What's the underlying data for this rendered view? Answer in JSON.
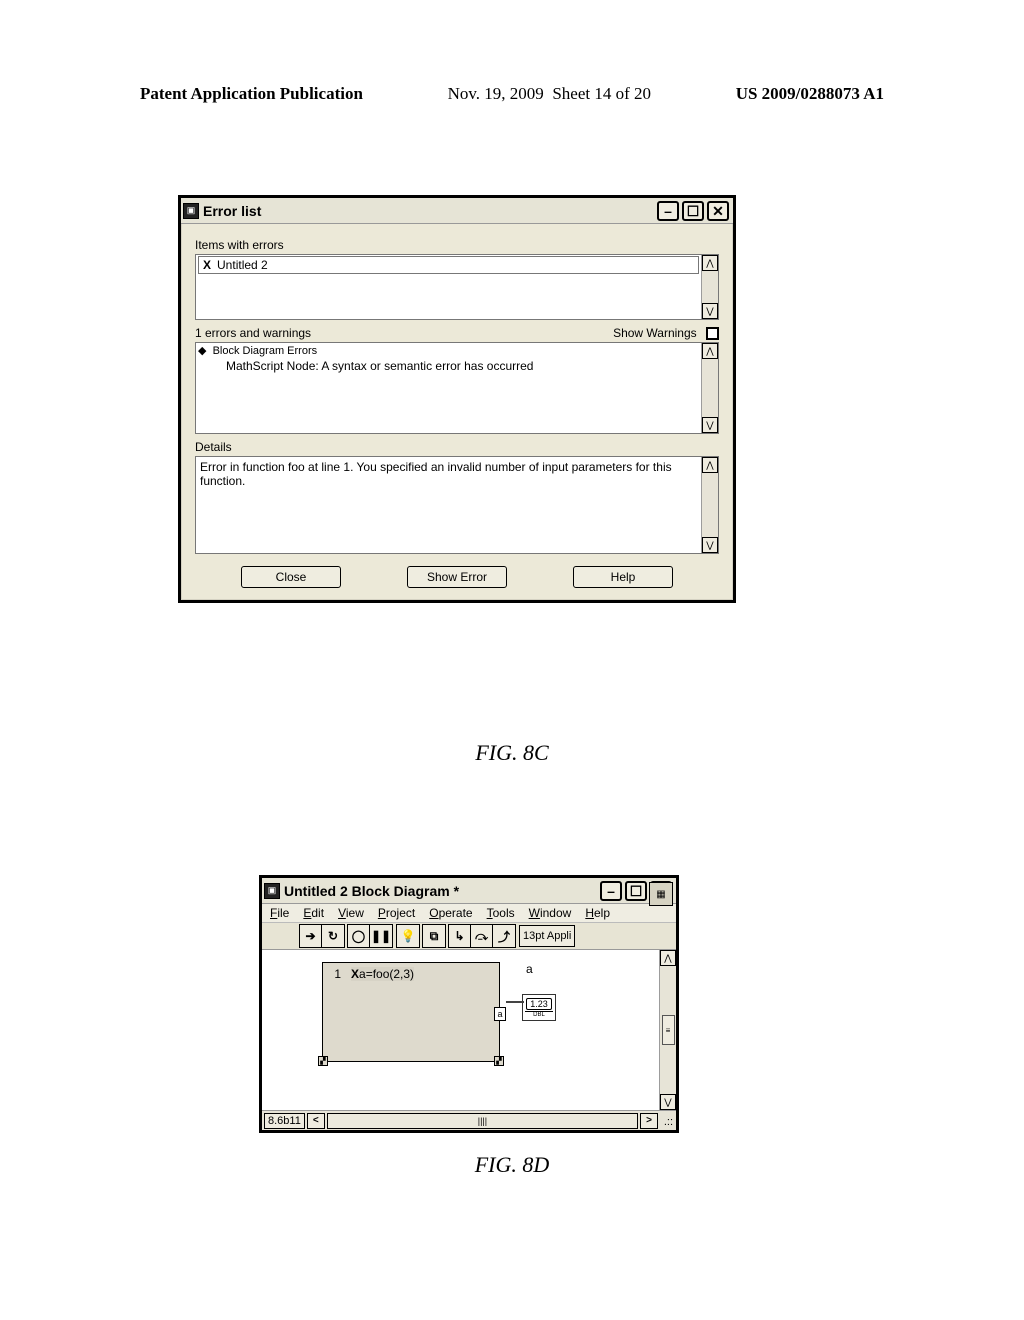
{
  "page_header": {
    "left": "Patent Application Publication",
    "date": "Nov. 19, 2009",
    "sheet": "Sheet 14 of 20",
    "pubno": "US 2009/0288073 A1"
  },
  "error_window": {
    "title": "Error list",
    "items_label": "Items with errors",
    "items": [
      {
        "name": "Untitled 2"
      }
    ],
    "errors_count_row": "1 errors and warnings",
    "show_warnings_label": "Show Warnings",
    "errors_section": {
      "heading": "Block Diagram Errors",
      "lines": [
        "MathScript Node: A syntax or semantic error has occurred"
      ]
    },
    "details_label": "Details",
    "details_text": "Error in function foo at line 1.  You specified an invalid number of input parameters for this function.",
    "buttons": {
      "close": "Close",
      "show_error": "Show Error",
      "help": "Help"
    }
  },
  "fig_caption_1": "FIG. 8C",
  "bd_window": {
    "title": "Untitled 2 Block Diagram *",
    "menu": [
      "File",
      "Edit",
      "View",
      "Project",
      "Operate",
      "Tools",
      "Window",
      "Help"
    ],
    "font_label": "13pt Appli",
    "canvas": {
      "line_number": "1",
      "code": "a=foo(2,3)",
      "out_terminal_label": "a",
      "indicator_label_top": "a",
      "indicator_value": "1.23",
      "indicator_type": "DBL"
    },
    "status_version": "8.6b11"
  },
  "fig_caption_2": "FIG. 8D"
}
